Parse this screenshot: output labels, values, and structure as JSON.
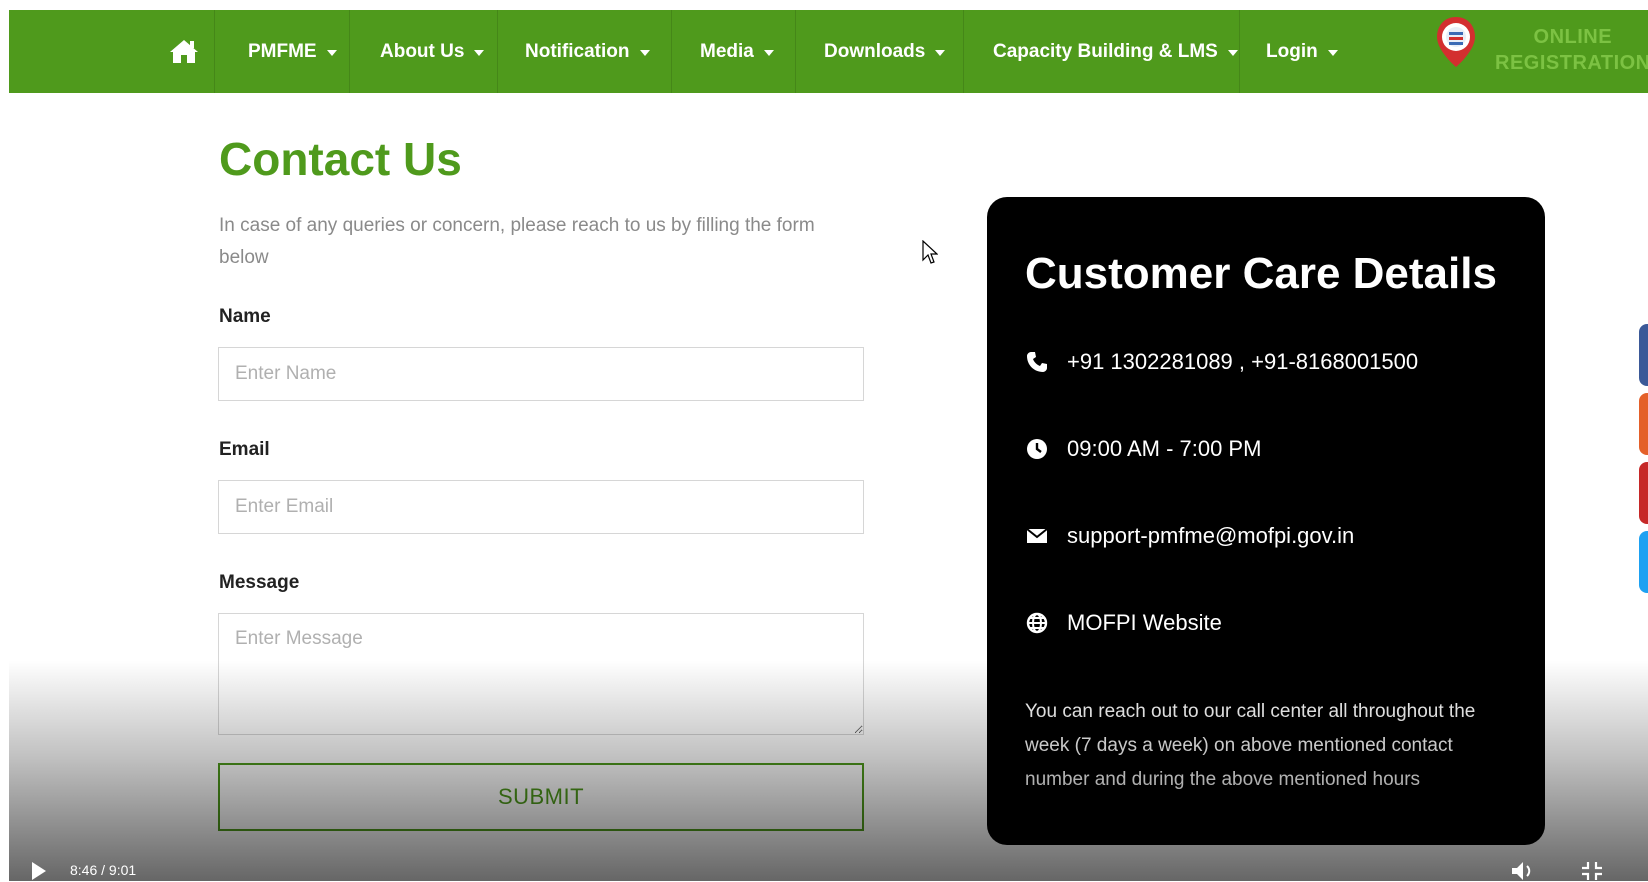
{
  "nav": {
    "items": [
      {
        "label": "PMFME"
      },
      {
        "label": "About Us"
      },
      {
        "label": "Notification"
      },
      {
        "label": "Media"
      },
      {
        "label": "Downloads"
      },
      {
        "label": "Capacity Building & LMS"
      },
      {
        "label": "Login"
      }
    ],
    "registration_line1": "ONLINE",
    "registration_line2": "REGISTRATION"
  },
  "form": {
    "title": "Contact Us",
    "intro": "In case of any queries or concern, please reach to us by filling the form below",
    "name_label": "Name",
    "name_placeholder": "Enter Name",
    "email_label": "Email",
    "email_placeholder": "Enter Email",
    "message_label": "Message",
    "message_placeholder": "Enter Message",
    "submit_label": "SUBMIT"
  },
  "care": {
    "title": "Customer Care Details",
    "phone": "+91 1302281089 , +91-8168001500",
    "hours": "09:00 AM - 7:00 PM",
    "email": "support-pmfme@mofpi.gov.in",
    "website": "MOFPI Website",
    "note": "You can reach out to our call center all throughout the week (7 days a week) on above mentioned contact number and during the above mentioned hours"
  },
  "video": {
    "time": "8:46 / 9:01"
  },
  "colors": {
    "brand_green": "#4f9a1c",
    "registration_text": "#7cc243",
    "card_bg": "#000000"
  },
  "icons": [
    "home-icon",
    "phone-icon",
    "clock-icon",
    "envelope-icon",
    "globe-icon",
    "play-icon",
    "volume-icon",
    "exit-fullscreen-icon"
  ]
}
